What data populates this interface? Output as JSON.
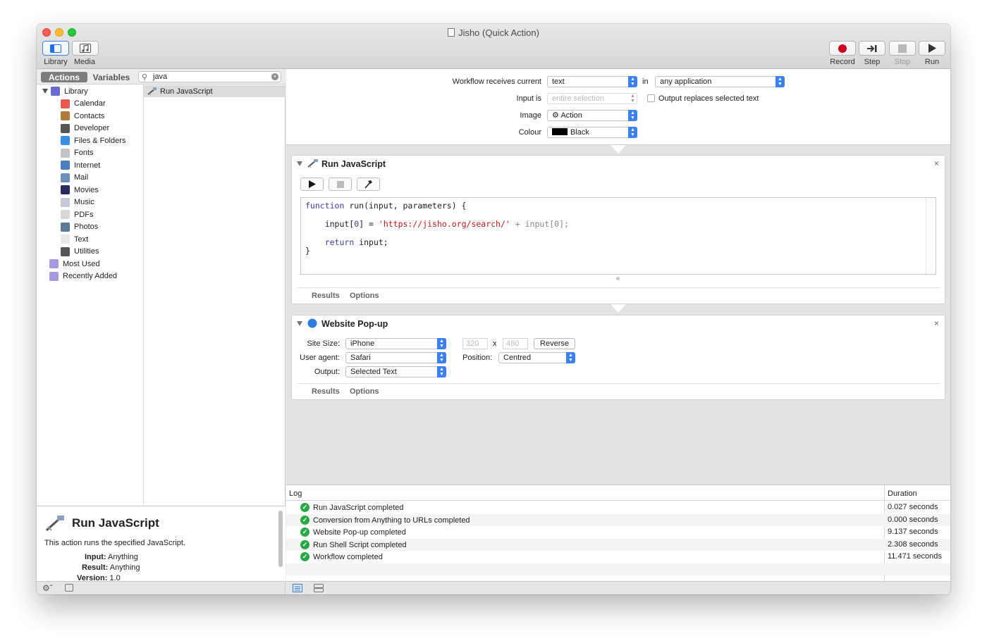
{
  "window": {
    "title": "Jisho (Quick Action)"
  },
  "toolbar": {
    "library": "Library",
    "media": "Media",
    "record": "Record",
    "step": "Step",
    "stop": "Stop",
    "run": "Run"
  },
  "library_pane": {
    "tab_actions": "Actions",
    "tab_variables": "Variables",
    "search_value": "java",
    "categories": [
      {
        "label": "Library",
        "icon": "library-icon",
        "color": "#6a6ad0"
      },
      {
        "label": "Calendar",
        "icon": "calendar-icon",
        "color": "#e85a4f"
      },
      {
        "label": "Contacts",
        "icon": "contacts-icon",
        "color": "#b07a3c"
      },
      {
        "label": "Developer",
        "icon": "developer-icon",
        "color": "#555555"
      },
      {
        "label": "Files & Folders",
        "icon": "files-folders-icon",
        "color": "#3a8ee8"
      },
      {
        "label": "Fonts",
        "icon": "fonts-icon",
        "color": "#c4c4c4"
      },
      {
        "label": "Internet",
        "icon": "internet-icon",
        "color": "#4a7fc0"
      },
      {
        "label": "Mail",
        "icon": "mail-icon",
        "color": "#6a8fb8"
      },
      {
        "label": "Movies",
        "icon": "movies-icon",
        "color": "#2a2a60"
      },
      {
        "label": "Music",
        "icon": "music-icon",
        "color": "#c8c8d8"
      },
      {
        "label": "PDFs",
        "icon": "pdfs-icon",
        "color": "#d8d8d8"
      },
      {
        "label": "Photos",
        "icon": "photos-icon",
        "color": "#5a7a9a"
      },
      {
        "label": "Text",
        "icon": "text-icon",
        "color": "#e8e8e8"
      },
      {
        "label": "Utilities",
        "icon": "utilities-icon",
        "color": "#555555"
      },
      {
        "label": "Most Used",
        "icon": "most-used-folder-icon",
        "color": "#a89ae0"
      },
      {
        "label": "Recently Added",
        "icon": "recently-added-folder-icon",
        "color": "#a89ae0"
      }
    ],
    "actions": [
      {
        "label": "Run JavaScript",
        "icon": "script-icon"
      }
    ]
  },
  "description": {
    "title": "Run JavaScript",
    "text": "This action runs the specified JavaScript.",
    "input_label": "Input:",
    "input_value": "Anything",
    "result_label": "Result:",
    "result_value": "Anything",
    "version_label": "Version:",
    "version_value": "1.0"
  },
  "workflow_header": {
    "receives_label": "Workflow receives current",
    "receives_value": "text",
    "in_label": "in",
    "app_value": "any application",
    "input_is_label": "Input is",
    "input_is_value": "entire selection",
    "output_replaces_label": "Output replaces selected text",
    "image_label": "Image",
    "image_value": "Action",
    "colour_label": "Colour",
    "colour_value": "Black",
    "colour_swatch": "#000000"
  },
  "run_js_action": {
    "title": "Run JavaScript",
    "code": {
      "line1_kw": "function",
      "line1_rest": " run(input, parameters) {",
      "line2_pre": "    input[",
      "line2_idx": "0",
      "line2_mid": "] = ",
      "line2_str": "'https://jisho.org/search/'",
      "line2_dim": " + input[0];",
      "line3_kw": "return",
      "line3_rest": " input;",
      "line4": "}"
    },
    "tab_results": "Results",
    "tab_options": "Options"
  },
  "website_popup_action": {
    "title": "Website Pop-up",
    "site_size_label": "Site Size:",
    "site_size_value": "iPhone",
    "width_value": "320",
    "x_label": "x",
    "height_value": "480",
    "reverse_label": "Reverse",
    "user_agent_label": "User agent:",
    "user_agent_value": "Safari",
    "position_label": "Position:",
    "position_value": "Centred",
    "output_label": "Output:",
    "output_value": "Selected Text",
    "tab_results": "Results",
    "tab_options": "Options"
  },
  "log": {
    "col_log": "Log",
    "col_duration": "Duration",
    "rows": [
      {
        "message": "Run JavaScript completed",
        "duration": "0.027 seconds"
      },
      {
        "message": "Conversion from Anything to URLs completed",
        "duration": "0.000 seconds"
      },
      {
        "message": "Website Pop-up completed",
        "duration": "9.137 seconds"
      },
      {
        "message": "Run Shell Script completed",
        "duration": "2.308 seconds"
      },
      {
        "message": "Workflow completed",
        "duration": "11.471 seconds"
      }
    ]
  }
}
